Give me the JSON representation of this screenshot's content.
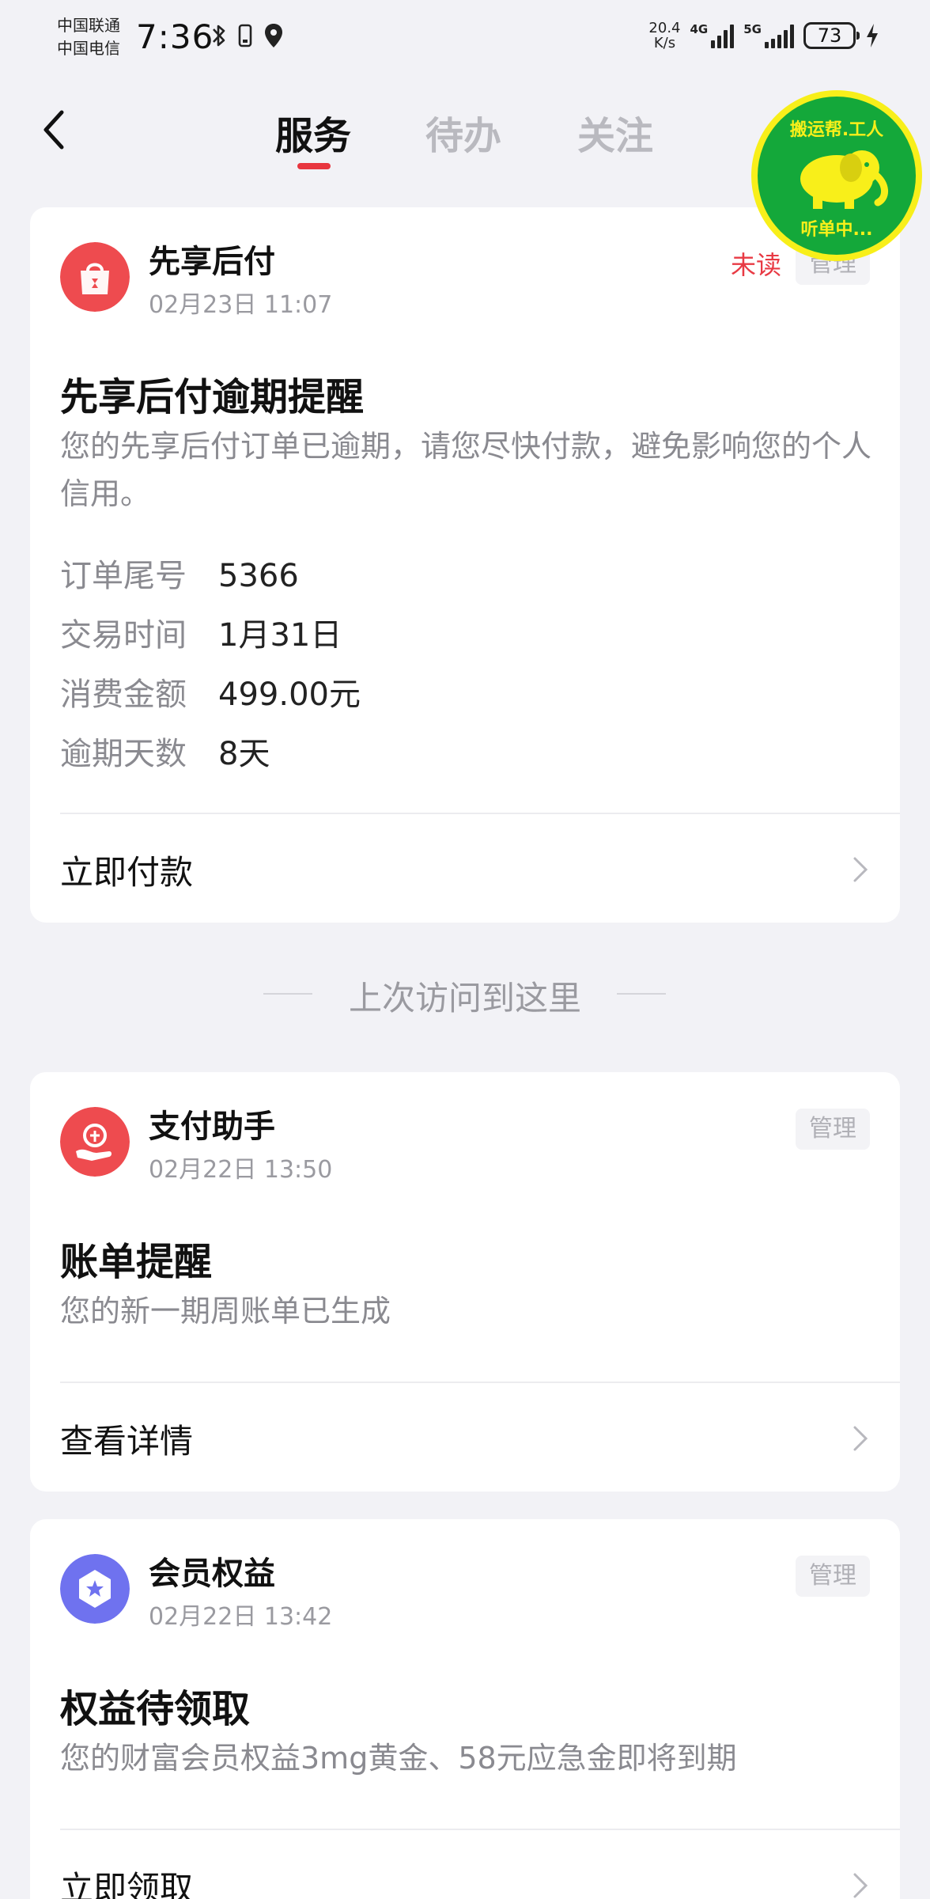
{
  "status_bar": {
    "carrier_1": "中国联通",
    "carrier_2": "中国电信",
    "time": "7:36",
    "speed_value": "20.4",
    "speed_unit": "K/s",
    "net_1": "4G",
    "net_2": "5G",
    "battery": "73"
  },
  "header": {
    "tabs": [
      {
        "label": "服务",
        "active": true
      },
      {
        "label": "待办",
        "active": false
      },
      {
        "label": "关注",
        "active": false
      }
    ],
    "accent": "#e8363f"
  },
  "mascot": {
    "text_top": "搬运帮.工人",
    "text_bottom": "听单中..."
  },
  "cards": [
    {
      "app_name": "先享后付",
      "time": "02月23日 11:07",
      "unread": "未读",
      "manage": "管理",
      "title": "先享后付逾期提醒",
      "desc": "您的先享后付订单已逾期，请您尽快付款，避免影响您的个人信用。",
      "details": [
        {
          "key": "订单尾号",
          "value": "5366"
        },
        {
          "key": "交易时间",
          "value": "1月31日"
        },
        {
          "key": "消费金额",
          "value": "499.00元"
        },
        {
          "key": "逾期天数",
          "value": "8天"
        }
      ],
      "action": "立即付款",
      "icon": "shopping-bag-icon",
      "icon_color": "#ee4b4f"
    },
    {
      "app_name": "支付助手",
      "time": "02月22日 13:50",
      "manage": "管理",
      "title": "账单提醒",
      "desc": "您的新一期周账单已生成",
      "action": "查看详情",
      "icon": "pay-hand-icon",
      "icon_color": "#ee4b4f"
    },
    {
      "app_name": "会员权益",
      "time": "02月22日 13:42",
      "manage": "管理",
      "title": "权益待领取",
      "desc": "您的财富会员权益3mg黄金、58元应急金即将到期",
      "action": "立即领取",
      "icon": "member-star-icon",
      "icon_color": "#6f72ef"
    }
  ],
  "visit_separator": "上次访问到这里"
}
